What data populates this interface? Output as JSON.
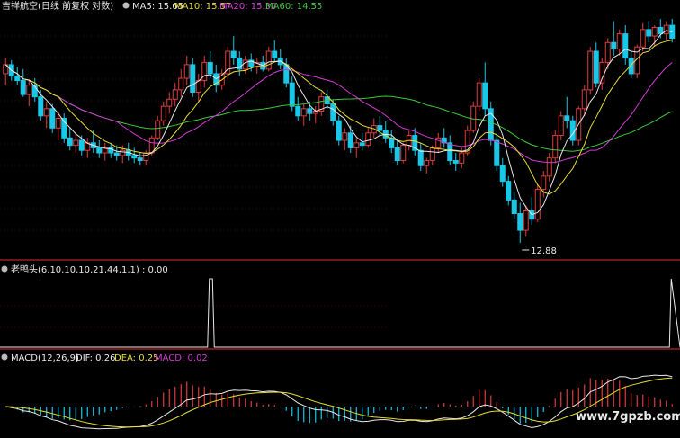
{
  "colors": {
    "bg": "#000000",
    "grid": "#3a0a0a",
    "border": "#9a1c1c",
    "up": "#e03c3c",
    "down": "#19c8e8",
    "ma5": "#e8e8e8",
    "ma10": "#e6dc32",
    "ma20": "#d23cd2",
    "ma60": "#3cc83c",
    "macd_neg": "#19c8e8"
  },
  "header": {
    "title": "吉祥航空(日线 前复权 对数)",
    "ma5": "MA5: 15.65",
    "ma10": "MA10: 15.57",
    "ma20": "MA20: 15.30",
    "ma60": "MA60: 14.55"
  },
  "indicator": {
    "label": "老鸭头(6,10,10,10,21,44,1,1) : 0.00"
  },
  "macd": {
    "name": "MACD(12,26,9)",
    "dif": "DIF: 0.26",
    "dea": "DEA: 0.25",
    "macd": "MACD: 0.02"
  },
  "annotation": {
    "low": "12.88"
  },
  "watermark": "www.7gpzb.com",
  "chart_data": {
    "type": "candlestick",
    "panels": [
      "price",
      "laoyatou",
      "macd"
    ],
    "candles": [
      [
        16.2,
        16.55,
        15.95,
        16.4
      ],
      [
        16.4,
        16.5,
        16.05,
        16.15
      ],
      [
        16.15,
        16.35,
        15.95,
        16.05
      ],
      [
        16.05,
        16.3,
        15.7,
        15.75
      ],
      [
        15.75,
        16.05,
        15.5,
        15.95
      ],
      [
        15.95,
        16.1,
        15.6,
        15.7
      ],
      [
        15.7,
        15.85,
        15.2,
        15.3
      ],
      [
        15.3,
        15.6,
        15.05,
        15.45
      ],
      [
        15.45,
        15.55,
        14.95,
        15.05
      ],
      [
        15.05,
        15.4,
        14.8,
        15.25
      ],
      [
        15.25,
        15.35,
        14.75,
        14.85
      ],
      [
        14.85,
        15.05,
        14.6,
        14.7
      ],
      [
        14.7,
        14.95,
        14.55,
        14.8
      ],
      [
        14.8,
        14.9,
        14.5,
        14.6
      ],
      [
        14.6,
        14.85,
        14.45,
        14.75
      ],
      [
        14.75,
        15.0,
        14.55,
        14.65
      ],
      [
        14.65,
        14.8,
        14.45,
        14.55
      ],
      [
        14.55,
        14.75,
        14.4,
        14.65
      ],
      [
        14.65,
        14.75,
        14.45,
        14.55
      ],
      [
        14.55,
        14.7,
        14.4,
        14.5
      ],
      [
        14.5,
        14.7,
        14.35,
        14.6
      ],
      [
        14.6,
        14.75,
        14.4,
        14.5
      ],
      [
        14.5,
        14.65,
        14.35,
        14.45
      ],
      [
        14.45,
        14.55,
        14.3,
        14.4
      ],
      [
        14.4,
        14.6,
        14.3,
        14.55
      ],
      [
        14.55,
        14.9,
        14.5,
        14.85
      ],
      [
        14.85,
        15.3,
        14.8,
        15.2
      ],
      [
        15.2,
        15.6,
        15.1,
        15.5
      ],
      [
        15.5,
        15.8,
        15.35,
        15.65
      ],
      [
        15.65,
        16.0,
        15.5,
        15.85
      ],
      [
        15.85,
        16.3,
        15.7,
        16.1
      ],
      [
        16.1,
        16.6,
        15.95,
        16.4
      ],
      [
        16.4,
        16.55,
        15.7,
        15.8
      ],
      [
        15.8,
        16.2,
        15.6,
        16.05
      ],
      [
        16.05,
        16.6,
        15.9,
        16.45
      ],
      [
        16.45,
        16.7,
        16.1,
        16.2
      ],
      [
        16.2,
        16.4,
        15.8,
        15.95
      ],
      [
        15.95,
        16.3,
        15.85,
        16.2
      ],
      [
        16.2,
        16.8,
        16.1,
        16.7
      ],
      [
        16.7,
        17.05,
        16.4,
        16.55
      ],
      [
        16.55,
        16.7,
        16.15,
        16.3
      ],
      [
        16.3,
        16.6,
        16.2,
        16.5
      ],
      [
        16.5,
        16.65,
        16.25,
        16.35
      ],
      [
        16.35,
        16.55,
        16.2,
        16.45
      ],
      [
        16.45,
        16.6,
        16.25,
        16.3
      ],
      [
        16.3,
        16.8,
        16.25,
        16.7
      ],
      [
        16.7,
        16.95,
        16.45,
        16.55
      ],
      [
        16.55,
        16.75,
        16.3,
        16.4
      ],
      [
        16.4,
        16.55,
        15.9,
        16.0
      ],
      [
        16.0,
        16.15,
        15.4,
        15.5
      ],
      [
        15.5,
        15.7,
        15.2,
        15.3
      ],
      [
        15.3,
        15.55,
        15.1,
        15.45
      ],
      [
        15.45,
        15.6,
        15.2,
        15.35
      ],
      [
        15.35,
        15.5,
        15.15,
        15.4
      ],
      [
        15.4,
        15.8,
        15.3,
        15.7
      ],
      [
        15.7,
        15.85,
        15.45,
        15.55
      ],
      [
        15.55,
        15.65,
        15.1,
        15.2
      ],
      [
        15.2,
        15.3,
        14.7,
        14.8
      ],
      [
        14.8,
        15.05,
        14.6,
        14.95
      ],
      [
        14.95,
        15.1,
        14.55,
        14.65
      ],
      [
        14.65,
        14.85,
        14.45,
        14.75
      ],
      [
        14.75,
        14.95,
        14.6,
        14.7
      ],
      [
        14.7,
        15.05,
        14.65,
        14.95
      ],
      [
        14.95,
        15.25,
        14.85,
        15.1
      ],
      [
        15.1,
        15.3,
        14.9,
        15.0
      ],
      [
        15.0,
        15.2,
        14.75,
        14.85
      ],
      [
        14.85,
        15.0,
        14.55,
        14.65
      ],
      [
        14.65,
        14.8,
        14.3,
        14.4
      ],
      [
        14.4,
        14.75,
        14.35,
        14.7
      ],
      [
        14.7,
        15.0,
        14.6,
        14.9
      ],
      [
        14.9,
        15.05,
        14.5,
        14.6
      ],
      [
        14.6,
        14.75,
        14.2,
        14.3
      ],
      [
        14.3,
        14.45,
        14.15,
        14.4
      ],
      [
        14.4,
        14.7,
        14.3,
        14.65
      ],
      [
        14.65,
        14.95,
        14.55,
        14.85
      ],
      [
        14.85,
        15.05,
        14.65,
        14.75
      ],
      [
        14.75,
        14.9,
        14.3,
        14.4
      ],
      [
        14.4,
        14.55,
        14.2,
        14.35
      ],
      [
        14.35,
        14.65,
        14.25,
        14.55
      ],
      [
        14.55,
        15.1,
        14.5,
        15.0
      ],
      [
        15.0,
        15.6,
        14.95,
        15.5
      ],
      [
        15.5,
        16.1,
        15.4,
        16.0
      ],
      [
        16.0,
        16.45,
        15.3,
        15.45
      ],
      [
        15.45,
        15.6,
        14.7,
        14.8
      ],
      [
        14.8,
        14.95,
        14.2,
        14.3
      ],
      [
        14.3,
        14.45,
        13.9,
        14.0
      ],
      [
        14.0,
        14.1,
        13.55,
        13.65
      ],
      [
        13.65,
        13.8,
        13.3,
        13.4
      ],
      [
        13.4,
        13.6,
        12.88,
        13.1
      ],
      [
        13.1,
        13.55,
        13.0,
        13.45
      ],
      [
        13.45,
        13.7,
        13.2,
        13.3
      ],
      [
        13.3,
        13.95,
        13.25,
        13.85
      ],
      [
        13.85,
        14.2,
        13.7,
        14.1
      ],
      [
        14.1,
        14.55,
        14.0,
        14.45
      ],
      [
        14.45,
        15.0,
        14.35,
        14.9
      ],
      [
        14.9,
        15.4,
        14.8,
        15.3
      ],
      [
        15.3,
        15.7,
        15.05,
        15.2
      ],
      [
        15.2,
        15.3,
        14.7,
        14.8
      ],
      [
        14.8,
        15.5,
        14.7,
        15.45
      ],
      [
        15.45,
        15.95,
        15.3,
        15.85
      ],
      [
        15.85,
        16.8,
        15.75,
        16.7
      ],
      [
        16.7,
        16.9,
        15.9,
        16.0
      ],
      [
        16.0,
        16.55,
        15.85,
        16.45
      ],
      [
        16.45,
        17.0,
        16.3,
        16.9
      ],
      [
        16.9,
        17.4,
        16.6,
        16.75
      ],
      [
        16.75,
        17.2,
        16.6,
        17.1
      ],
      [
        17.1,
        17.3,
        16.4,
        16.55
      ],
      [
        16.55,
        16.7,
        16.1,
        16.2
      ],
      [
        16.2,
        16.85,
        16.1,
        16.8
      ],
      [
        16.8,
        17.35,
        16.7,
        17.2
      ],
      [
        17.2,
        17.4,
        16.9,
        17.05
      ],
      [
        17.05,
        17.3,
        16.8,
        17.25
      ],
      [
        17.25,
        17.45,
        17.0,
        17.1
      ],
      [
        17.1,
        17.4,
        16.95,
        17.3
      ],
      [
        17.3,
        17.45,
        16.9,
        17.0
      ]
    ],
    "laoyatou_signal_bars": [
      35,
      114,
      115,
      116,
      117
    ],
    "ylim_log": [
      12.6,
      17.6
    ]
  }
}
